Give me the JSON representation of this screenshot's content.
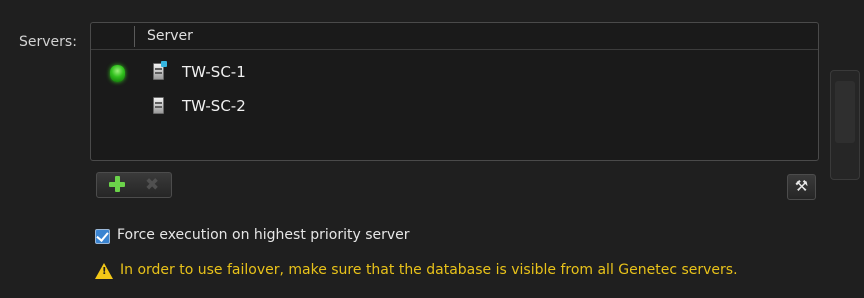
{
  "servers_label": "Servers:",
  "grid": {
    "column_header": "Server",
    "rows": [
      {
        "name": "TW-SC-1",
        "status": "online",
        "icon": "server-primary-icon"
      },
      {
        "name": "TW-SC-2",
        "status": "",
        "icon": "server-icon"
      }
    ]
  },
  "toolbar": {
    "add_icon": "plus-icon",
    "delete_icon": "delete-icon",
    "delete_glyph": "✖",
    "tools_icon": "tools-icon",
    "tools_glyph": "⚒"
  },
  "options": {
    "force_execution_label": "Force execution on highest priority server",
    "force_execution_checked": true
  },
  "warning": {
    "glyph": "!",
    "text": "In order to use failover, make sure that the database is visible from all Genetec servers."
  },
  "colors": {
    "background": "#1f1f1f",
    "warning_text": "#e8c21a",
    "status_online": "#2fbf1c",
    "checkbox_accent": "#3a84d1"
  }
}
